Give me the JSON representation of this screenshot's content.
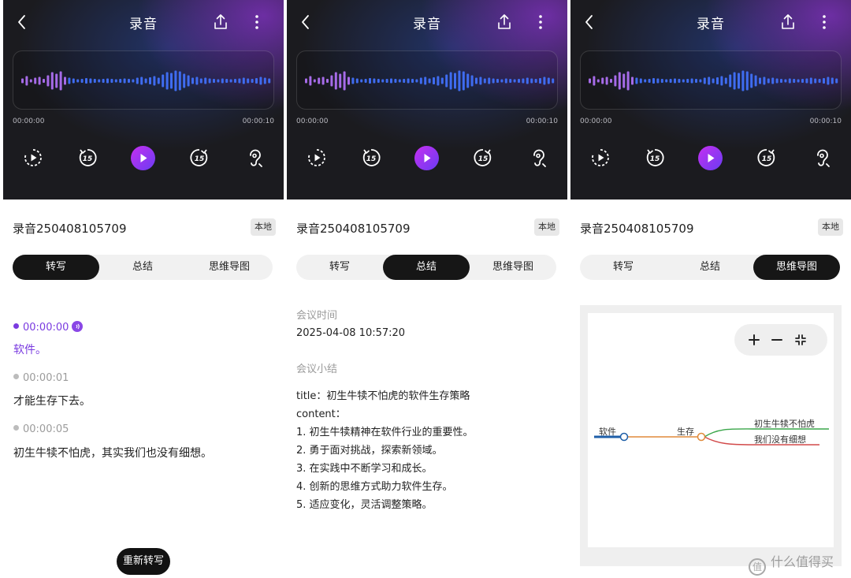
{
  "app": {
    "title": "录音"
  },
  "player": {
    "time_start": "00:00:00",
    "time_end": "00:00:10"
  },
  "recording": {
    "name": "录音250408105709",
    "badge": "本地"
  },
  "tabs": [
    "转写",
    "总结",
    "思维导图"
  ],
  "transcript": {
    "segments": [
      {
        "time": "00:00:00",
        "text": "软件。",
        "active": true
      },
      {
        "time": "00:00:01",
        "text": "才能生存下去。",
        "active": false
      },
      {
        "time": "00:00:05",
        "text": "初生牛犊不怕虎，其实我们也没有细想。",
        "active": false
      }
    ],
    "retranscribe_label": "重新转写"
  },
  "summary": {
    "meeting_time_label": "会议时间",
    "meeting_time": "2025-04-08 10:57:20",
    "brief_label": "会议小结",
    "lines": [
      "title：初生牛犊不怕虎的软件生存策略",
      "content：",
      "1. 初生牛犊精神在软件行业的重要性。",
      "2. 勇于面对挑战，探索新领域。",
      "3. 在实践中不断学习和成长。",
      "4. 创新的思维方式助力软件生存。",
      "5. 适应变化，灵活调整策略。"
    ]
  },
  "mindmap": {
    "root": "软件",
    "child": "生存",
    "leaves": [
      "初生牛犊不怕虎",
      "我们没有细想"
    ]
  },
  "colors": {
    "accent_purple": "#7a3be0",
    "wave_purple": "#a66be8",
    "wave_blue": "#3f6cf0",
    "root_line": "#1f5fa8",
    "child_line": "#e08a3a",
    "leaf1_line": "#3aa64a",
    "leaf2_line": "#d24a4a"
  },
  "watermark": "什么值得买"
}
